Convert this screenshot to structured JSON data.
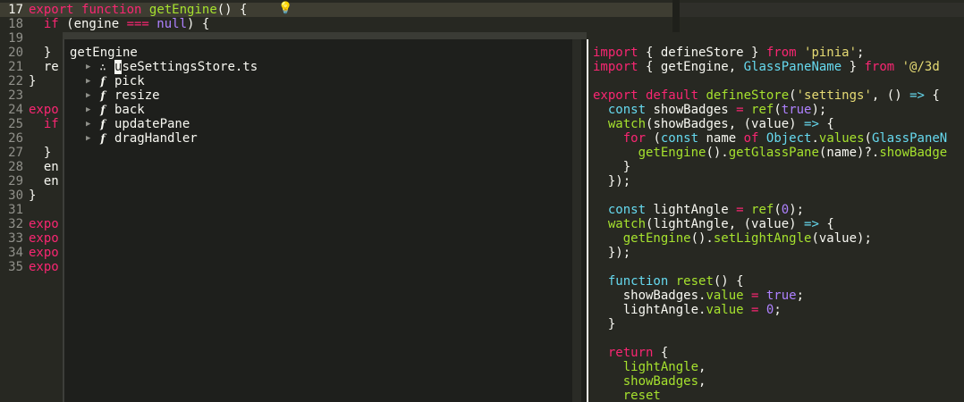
{
  "editor": {
    "line_numbers": [
      "17",
      "18",
      "19",
      "20",
      "21",
      "22",
      "23",
      "24",
      "25",
      "26",
      "27",
      "28",
      "29",
      "30",
      "31",
      "32",
      "33",
      "34",
      "35"
    ],
    "lines": [
      [
        [
          "kw",
          "export"
        ],
        [
          "",
          " "
        ],
        [
          "kw",
          "function"
        ],
        [
          "",
          " "
        ],
        [
          "fn",
          "getEngine"
        ],
        [
          "",
          "() {  "
        ]
      ],
      [
        [
          "",
          "  "
        ],
        [
          "kw",
          "if"
        ],
        [
          "",
          " (engine "
        ],
        [
          "kw",
          "==="
        ],
        [
          "",
          ""
        ],
        [
          "cn",
          " null"
        ],
        [
          "",
          ") {"
        ]
      ],
      [
        [
          "",
          ""
        ]
      ],
      [
        [
          "",
          "  }"
        ]
      ],
      [
        [
          "",
          "  re"
        ]
      ],
      [
        [
          "",
          "}"
        ]
      ],
      [
        [
          "",
          ""
        ]
      ],
      [
        [
          "kw",
          "expo"
        ]
      ],
      [
        [
          "",
          "  "
        ],
        [
          "kw",
          "if"
        ]
      ],
      [
        [
          "",
          ""
        ]
      ],
      [
        [
          "",
          "  }"
        ]
      ],
      [
        [
          "",
          "  en"
        ]
      ],
      [
        [
          "",
          "  en"
        ]
      ],
      [
        [
          "",
          "}"
        ]
      ],
      [
        [
          "",
          ""
        ]
      ],
      [
        [
          "kw",
          "expo"
        ]
      ],
      [
        [
          "kw",
          "expo"
        ]
      ],
      [
        [
          "kw",
          "expo"
        ]
      ],
      [
        [
          "kw",
          "expo"
        ]
      ]
    ]
  },
  "peek": {
    "title": "getEngine",
    "tree": [
      {
        "icon": "module-icon",
        "glyph": "∴",
        "first": "u",
        "rest": "seSettingsStore.ts"
      },
      {
        "icon": "function-icon",
        "glyph": "f",
        "first": "",
        "rest": "pick"
      },
      {
        "icon": "function-icon",
        "glyph": "f",
        "first": "",
        "rest": "resize"
      },
      {
        "icon": "function-icon",
        "glyph": "f",
        "first": "",
        "rest": "back"
      },
      {
        "icon": "function-icon",
        "glyph": "f",
        "first": "",
        "rest": "updatePane"
      },
      {
        "icon": "function-icon",
        "glyph": "f",
        "first": "",
        "rest": "dragHandler"
      }
    ],
    "preview_lines": [
      [
        [
          "kw",
          "import"
        ],
        [
          "",
          " { defineStore } "
        ],
        [
          "kw",
          "from"
        ],
        [
          "str",
          " 'pinia'"
        ],
        [
          "",
          ";"
        ]
      ],
      [
        [
          "kw",
          "import"
        ],
        [
          "",
          " { getEngine, "
        ],
        [
          "ty",
          "GlassPaneName"
        ],
        [
          "",
          " } "
        ],
        [
          "kw",
          "from"
        ],
        [
          "str",
          " '@/3d"
        ]
      ],
      [
        [
          "",
          ""
        ]
      ],
      [
        [
          "kw",
          "export"
        ],
        [
          "kw",
          " default"
        ],
        [
          "fn",
          " defineStore"
        ],
        [
          "",
          "("
        ],
        [
          "str",
          "'settings'"
        ],
        [
          "",
          ", () "
        ],
        [
          "ty",
          "=>"
        ],
        [
          "",
          " {"
        ]
      ],
      [
        [
          "",
          "  "
        ],
        [
          "ty",
          "const"
        ],
        [
          "",
          " showBadges "
        ],
        [
          "kw",
          "="
        ],
        [
          "fn",
          " ref"
        ],
        [
          "",
          "("
        ],
        [
          "cn",
          "true"
        ],
        [
          "",
          ");"
        ]
      ],
      [
        [
          "",
          "  "
        ],
        [
          "fn",
          "watch"
        ],
        [
          "",
          "(showBadges, (value) "
        ],
        [
          "ty",
          "=>"
        ],
        [
          "",
          " {"
        ]
      ],
      [
        [
          "",
          "    "
        ],
        [
          "kw",
          "for"
        ],
        [
          "",
          " ("
        ],
        [
          "ty",
          "const"
        ],
        [
          "",
          " name "
        ],
        [
          "kw",
          "of"
        ],
        [
          "ty",
          " Object"
        ],
        [
          "",
          "."
        ],
        [
          "fn",
          "values"
        ],
        [
          "",
          "("
        ],
        [
          "ty",
          "GlassPaneN"
        ]
      ],
      [
        [
          "",
          "      "
        ],
        [
          "fn",
          "getEngine"
        ],
        [
          "",
          "()."
        ],
        [
          "fn",
          "getGlassPane"
        ],
        [
          "",
          "(name)?."
        ],
        [
          "fn",
          "showBadge"
        ]
      ],
      [
        [
          "",
          "    }"
        ]
      ],
      [
        [
          "",
          "  });"
        ]
      ],
      [
        [
          "",
          ""
        ]
      ],
      [
        [
          "",
          "  "
        ],
        [
          "ty",
          "const"
        ],
        [
          "",
          " lightAngle "
        ],
        [
          "kw",
          "="
        ],
        [
          "fn",
          " ref"
        ],
        [
          "",
          "("
        ],
        [
          "cn",
          "0"
        ],
        [
          "",
          ");"
        ]
      ],
      [
        [
          "",
          "  "
        ],
        [
          "fn",
          "watch"
        ],
        [
          "",
          "(lightAngle, (value) "
        ],
        [
          "ty",
          "=>"
        ],
        [
          "",
          " {"
        ]
      ],
      [
        [
          "",
          "    "
        ],
        [
          "fn",
          "getEngine"
        ],
        [
          "",
          "()."
        ],
        [
          "fn",
          "setLightAngle"
        ],
        [
          "",
          "(value);"
        ]
      ],
      [
        [
          "",
          "  });"
        ]
      ],
      [
        [
          "",
          ""
        ]
      ],
      [
        [
          "",
          "  "
        ],
        [
          "ty",
          "function"
        ],
        [
          "fn",
          " reset"
        ],
        [
          "",
          "() {"
        ]
      ],
      [
        [
          "",
          "    showBadges."
        ],
        [
          "fn",
          "value"
        ],
        [
          "kw",
          " ="
        ],
        [
          "cn",
          " true"
        ],
        [
          "",
          ";"
        ]
      ],
      [
        [
          "",
          "    lightAngle."
        ],
        [
          "fn",
          "value"
        ],
        [
          "kw",
          " ="
        ],
        [
          "cn",
          " 0"
        ],
        [
          "",
          ";"
        ]
      ],
      [
        [
          "",
          "  }"
        ]
      ],
      [
        [
          "",
          ""
        ]
      ],
      [
        [
          "",
          "  "
        ],
        [
          "kw",
          "return"
        ],
        [
          "",
          " {"
        ]
      ],
      [
        [
          "",
          "    "
        ],
        [
          "fn",
          "lightAngle"
        ],
        [
          "",
          ","
        ]
      ],
      [
        [
          "",
          "    "
        ],
        [
          "fn",
          "showBadges"
        ],
        [
          "",
          ","
        ]
      ],
      [
        [
          "",
          "    "
        ],
        [
          "fn",
          "reset"
        ]
      ]
    ]
  },
  "icons": {
    "lightbulb": "lightbulb-icon",
    "lightbulb_glyph": "💡",
    "arrow_glyph": "▶"
  }
}
